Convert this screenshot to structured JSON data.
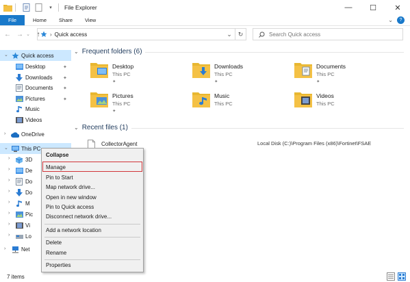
{
  "window": {
    "title": "File Explorer",
    "controls": {
      "minimize": "—",
      "maximize": "☐",
      "close": "✕"
    }
  },
  "ribbon": {
    "tabs": [
      "File",
      "Home",
      "Share",
      "View"
    ],
    "help": "?"
  },
  "address": {
    "location": "Quick access",
    "dropdown": "⌄",
    "refresh": "↻",
    "search_placeholder": "Search Quick access"
  },
  "sidebar": {
    "quick_access": "Quick access",
    "items": [
      {
        "label": "Desktop",
        "pinned": true
      },
      {
        "label": "Downloads",
        "pinned": true
      },
      {
        "label": "Documents",
        "pinned": true
      },
      {
        "label": "Pictures",
        "pinned": true
      },
      {
        "label": "Music",
        "pinned": false
      },
      {
        "label": "Videos",
        "pinned": false
      }
    ],
    "onedrive": "OneDrive",
    "this_pc": "This PC",
    "this_pc_children": [
      "3D",
      "De",
      "Do",
      "Do",
      "M",
      "Pic",
      "Vi",
      "Lo"
    ],
    "network": "Net"
  },
  "main": {
    "frequent_header": "Frequent folders (6)",
    "folders": [
      {
        "name": "Desktop",
        "sub": "This PC",
        "pinned": true
      },
      {
        "name": "Downloads",
        "sub": "This PC",
        "pinned": true
      },
      {
        "name": "Documents",
        "sub": "This PC",
        "pinned": true
      },
      {
        "name": "Pictures",
        "sub": "This PC",
        "pinned": true
      },
      {
        "name": "Music",
        "sub": "This PC",
        "pinned": false
      },
      {
        "name": "Videos",
        "sub": "This PC",
        "pinned": false
      }
    ],
    "recent_header": "Recent files (1)",
    "recent": [
      {
        "name": "CollectorAgent",
        "path": "Local Disk (C:)\\Program Files (x86)\\Fortinet\\FSAE"
      }
    ]
  },
  "context_menu": {
    "items": [
      "Collapse",
      "Manage",
      "Pin to Start",
      "Map network drive...",
      "Open in new window",
      "Pin to Quick access",
      "Disconnect network drive...",
      "Add a network location",
      "Delete",
      "Rename",
      "Properties"
    ],
    "highlighted": "Manage"
  },
  "status": {
    "items_count": "7 items"
  },
  "colors": {
    "accent": "#1979ca",
    "folder": "#f4c145",
    "selection": "#cce8ff",
    "highlight_box": "#d13438"
  }
}
